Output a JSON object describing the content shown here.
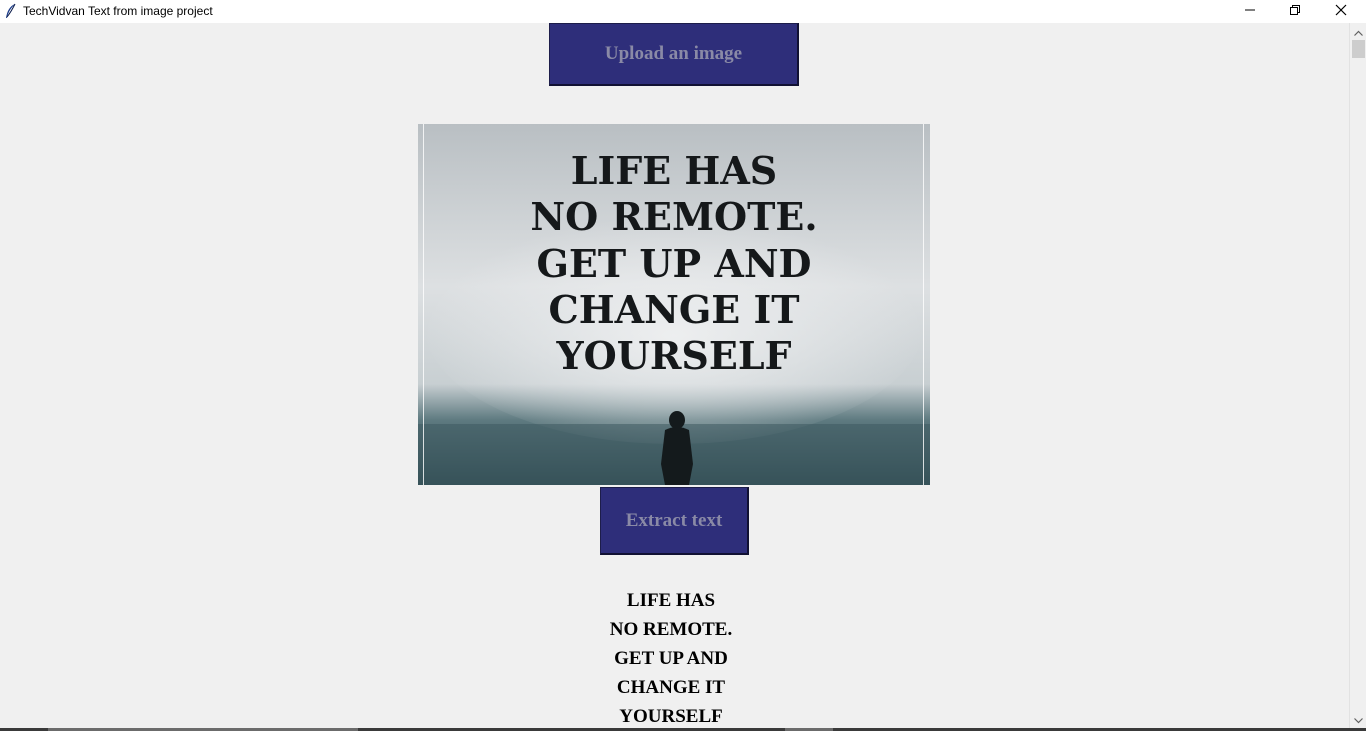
{
  "window": {
    "title": "TechVidvan Text from image project",
    "icons": {
      "app": "feather-icon",
      "minimize": "minimize-icon",
      "maximize": "restore-icon",
      "close": "close-icon"
    }
  },
  "buttons": {
    "upload_label": "Upload an image",
    "extract_label": "Extract text"
  },
  "image": {
    "description_icon": "uploaded-image",
    "text_lines": [
      "LIFE HAS",
      "NO REMOTE.",
      "GET UP AND",
      "CHANGE IT",
      "YOURSELF"
    ]
  },
  "result": {
    "lines": [
      "LIFE HAS",
      "NO REMOTE.",
      "GET UP AND",
      "CHANGE IT",
      "YOURSELF"
    ]
  },
  "colors": {
    "button_bg": "#2e2e7a",
    "button_text": "#8a8aa6",
    "background": "#f0f0f0"
  }
}
